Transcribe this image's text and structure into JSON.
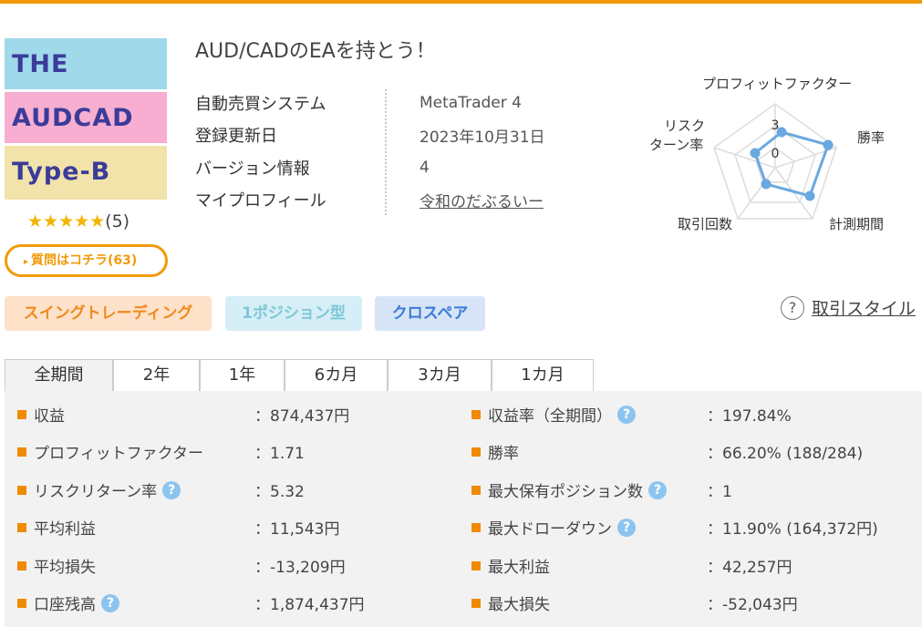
{
  "logo": {
    "line1": "THE",
    "line2": "AUDCAD",
    "line3": "Type-B"
  },
  "rating": {
    "stars": "★★★★★",
    "count": "(5)"
  },
  "question_button": {
    "arrow": "▸",
    "label": "質問はコチラ(63)"
  },
  "title": "AUD/CADのEAを持とう！",
  "info": [
    {
      "key": "自動売買システム",
      "value": "MetaTrader 4"
    },
    {
      "key": "登録更新日",
      "value": "2023年10月31日"
    },
    {
      "key": "バージョン情報",
      "value": "4"
    },
    {
      "key": "マイプロフィール",
      "value": "令和のだぶるいー"
    }
  ],
  "radar": {
    "labels": {
      "pf": "プロフィットファクター",
      "winrate": "勝率",
      "period": "計測期間",
      "trades": "取引回数",
      "risk_line1": "リスク",
      "risk_line2": "ターン率"
    },
    "scale": {
      "max": "3",
      "zero": "0"
    },
    "color": "#6aa8e0"
  },
  "tags": [
    "スイングトレーディング",
    "1ポジション型",
    "クロスペア"
  ],
  "style_link": {
    "icon": "?",
    "label": "取引スタイル"
  },
  "tabs": [
    "全期間",
    "2年",
    "1年",
    "6カ月",
    "3カ月",
    "1カ月"
  ],
  "stats_left": [
    {
      "label": "収益",
      "value": "：874,437円"
    },
    {
      "label": "プロフィットファクター",
      "value": "：1.71"
    },
    {
      "label": "リスクリターン率",
      "value": "：5.32"
    },
    {
      "label": "平均利益",
      "value": "：11,543円"
    },
    {
      "label": "平均損失",
      "value": "：-13,209円"
    },
    {
      "label": "口座残高",
      "value": "：1,874,437円"
    }
  ],
  "stats_right": [
    {
      "label": "収益率（全期間）",
      "value": "：197.84%"
    },
    {
      "label": "勝率",
      "value": "：66.20% (188/284)"
    },
    {
      "label": "最大保有ポジション数",
      "value": "：1"
    },
    {
      "label": "最大ドローダウン",
      "value": "：11.90% (164,372円)"
    },
    {
      "label": "最大利益",
      "value": "：42,257円"
    },
    {
      "label": "最大損失",
      "value": "：-52,043円"
    }
  ],
  "help_icon": "?",
  "colors": {
    "accent": "#f29a0b",
    "bullet": "#f08a00",
    "help": "#8cc4f0"
  }
}
